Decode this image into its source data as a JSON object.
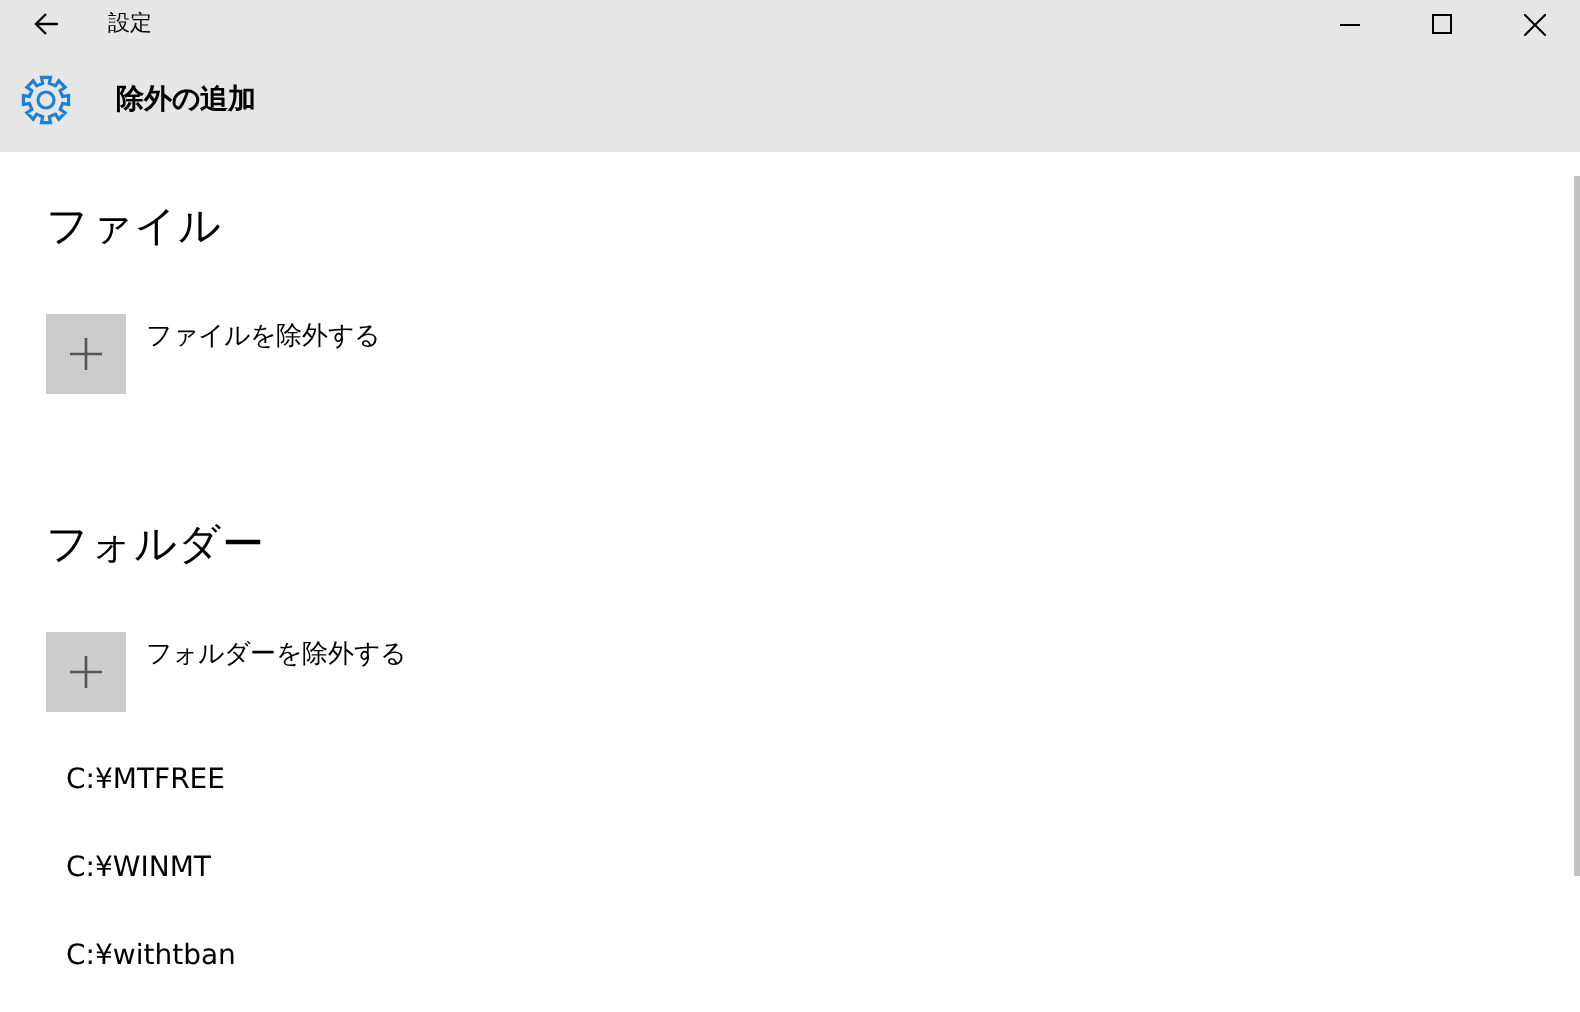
{
  "window": {
    "title": "設定"
  },
  "header": {
    "title": "除外の追加"
  },
  "sections": [
    {
      "heading": "ファイル",
      "add_label": "ファイルを除外する"
    },
    {
      "heading": "フォルダー",
      "add_label": "フォルダーを除外する",
      "items": [
        "C:¥MTFREE",
        "C:¥WINMT",
        "C:¥withtban"
      ]
    }
  ]
}
